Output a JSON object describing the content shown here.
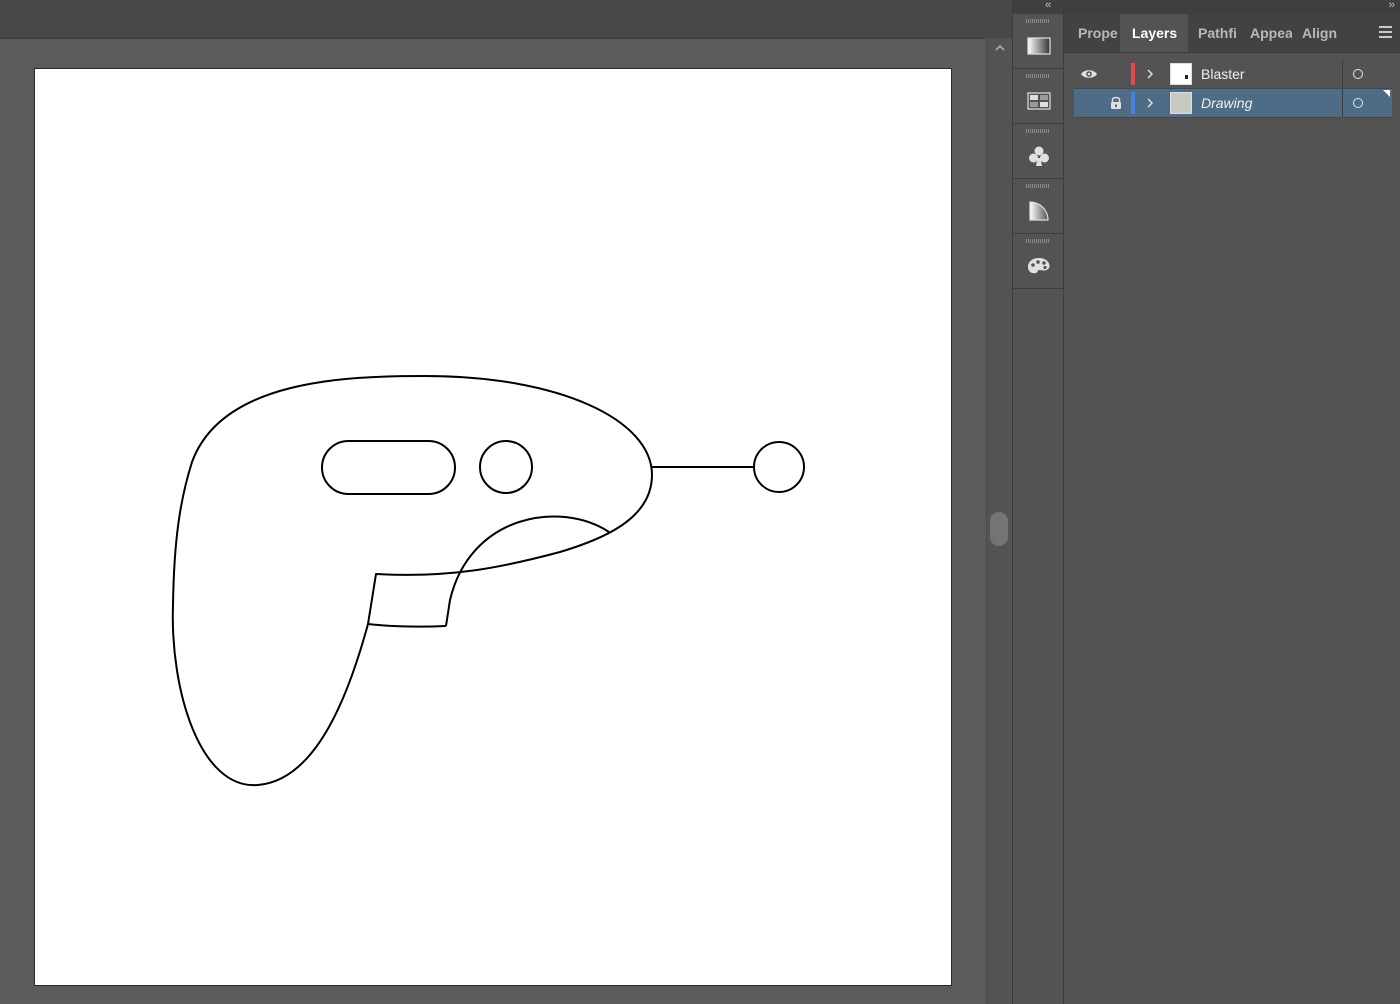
{
  "panel": {
    "tabs": [
      {
        "label": "Prope"
      },
      {
        "label": "Layers"
      },
      {
        "label": "Pathfi"
      },
      {
        "label": "Appea"
      },
      {
        "label": "Align"
      }
    ],
    "active_tab": "Layers",
    "collapse_left": "‹‹",
    "collapse_right": "››"
  },
  "layers": [
    {
      "name": "Blaster",
      "visible": true,
      "locked": false,
      "color": "#e8484a",
      "selected": false
    },
    {
      "name": "Drawing",
      "visible": false,
      "locked": true,
      "color": "#4a7fe0",
      "selected": true
    }
  ],
  "dock": {
    "icons": [
      "gradient-icon",
      "swatches-icon",
      "symbols-icon",
      "graphic-styles-icon",
      "brushes-icon"
    ]
  },
  "canvas": {
    "artboard_background": "#ffffff",
    "stroke_color": "#000000"
  }
}
